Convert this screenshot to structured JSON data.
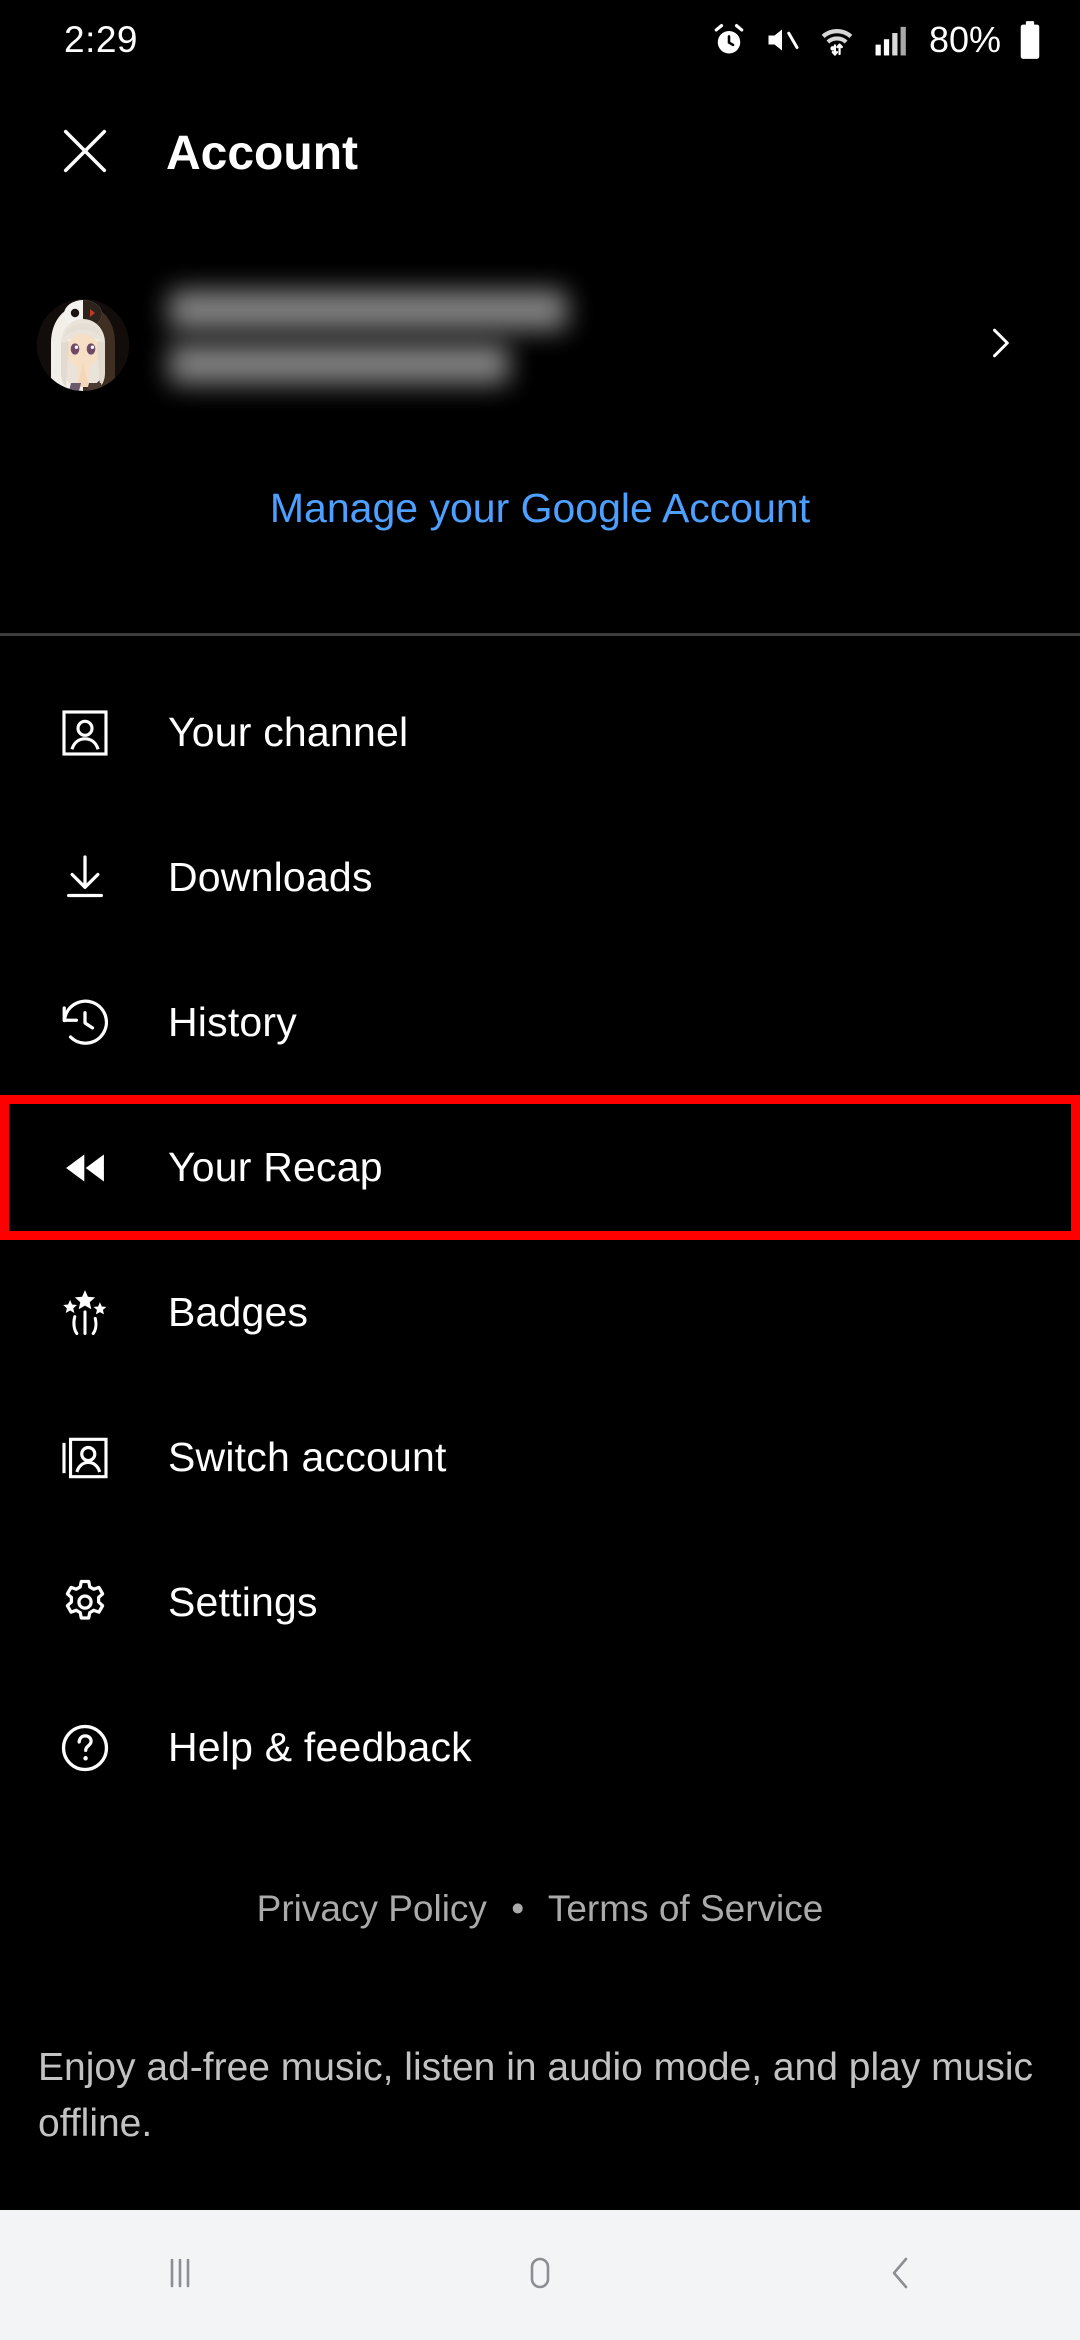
{
  "statusbar": {
    "time": "2:29",
    "battery_percent": "80%",
    "icons": [
      "alarm-icon",
      "mute-icon",
      "wifi-icon",
      "signal-icon",
      "battery-icon"
    ]
  },
  "header": {
    "close_icon": "close-icon",
    "title": "Account"
  },
  "account": {
    "avatar": "user-avatar",
    "name_redacted": true,
    "chevron_icon": "chevron-right-icon",
    "manage_link": "Manage your Google Account"
  },
  "menu": {
    "items": [
      {
        "label": "Your channel",
        "icon": "person-square-icon",
        "highlighted": false
      },
      {
        "label": "Downloads",
        "icon": "download-icon",
        "highlighted": false
      },
      {
        "label": "History",
        "icon": "history-clock-icon",
        "highlighted": false
      },
      {
        "label": "Your Recap",
        "icon": "rewind-icon",
        "highlighted": true
      },
      {
        "label": "Badges",
        "icon": "sparkle-stars-icon",
        "highlighted": false
      },
      {
        "label": "Switch account",
        "icon": "switch-account-icon",
        "highlighted": false
      },
      {
        "label": "Settings",
        "icon": "gear-icon",
        "highlighted": false
      },
      {
        "label": "Help & feedback",
        "icon": "question-circle-icon",
        "highlighted": false
      }
    ]
  },
  "footer": {
    "privacy_policy": "Privacy Policy",
    "separator": "•",
    "terms_of_service": "Terms of Service",
    "promo_text": "Enjoy ad-free music, listen in audio mode, and play music offline."
  },
  "navbar": {
    "recents": "recents-icon",
    "home": "home-icon",
    "back": "back-icon"
  },
  "colors": {
    "background": "#000000",
    "text_primary": "#ffffff",
    "text_secondary": "#c2c2c2",
    "link_blue": "#4da0ff",
    "highlight_red": "#fe0000",
    "navbar_bg": "#f3f4f6"
  }
}
